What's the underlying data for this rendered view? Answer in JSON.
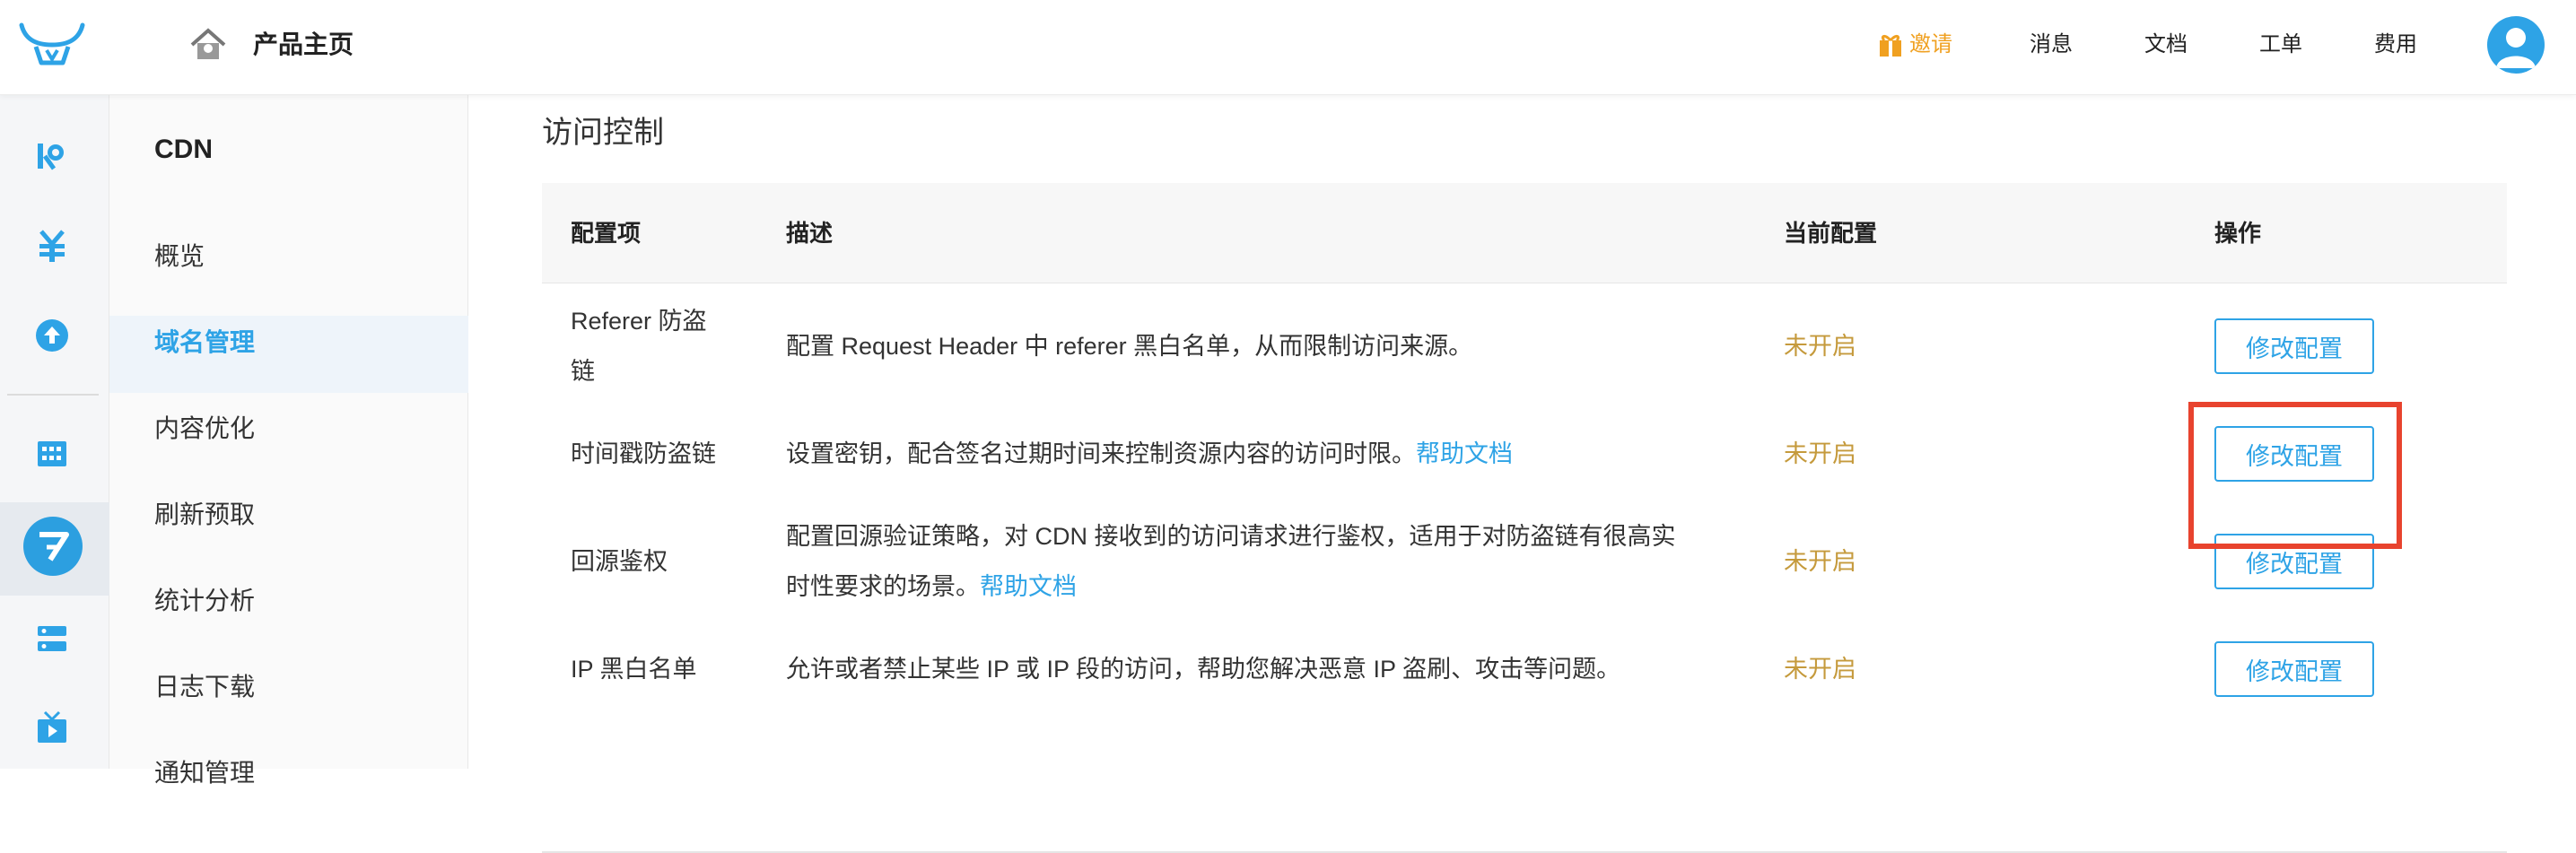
{
  "header": {
    "home_title": "产品主页",
    "nav": {
      "invite": "邀请",
      "messages": "消息",
      "docs": "文档",
      "tickets": "工单",
      "billing": "费用"
    }
  },
  "rail": {
    "icons": [
      "kodo-icon",
      "pricing-icon",
      "upload-icon",
      "dashboard-icon",
      "cdn-icon",
      "settings-icon",
      "video-icon"
    ],
    "active": "cdn-icon"
  },
  "sidebar": {
    "title": "CDN",
    "items": [
      {
        "label": "概览"
      },
      {
        "label": "域名管理",
        "active": true
      },
      {
        "label": "内容优化"
      },
      {
        "label": "刷新预取"
      },
      {
        "label": "统计分析"
      },
      {
        "label": "日志下载"
      },
      {
        "label": "通知管理"
      }
    ]
  },
  "main": {
    "section_title": "访问控制",
    "columns": [
      "配置项",
      "描述",
      "当前配置",
      "操作"
    ],
    "rows": [
      {
        "name_line1": "Referer 防盗",
        "name_line2": "链",
        "desc": "配置 Request Header 中 referer 黑白名单，从而限制访问来源。",
        "status": "未开启",
        "action": "修改配置"
      },
      {
        "name": "时间戳防盗链",
        "desc": "设置密钥，配合签名过期时间来控制资源内容的访问时限。",
        "link": "帮助文档",
        "status": "未开启",
        "action": "修改配置"
      },
      {
        "name": "回源鉴权",
        "desc_line1": "配置回源验证策略，对 CDN 接收到的访问请求进行鉴权，适用于对防盗链有很高实",
        "desc_line2": "时性要求的场景。",
        "link": "帮助文档",
        "status": "未开启",
        "action": "修改配置"
      },
      {
        "name": "IP 黑白名单",
        "desc": "允许或者禁止某些 IP 或 IP 段的访问，帮助您解决恶意 IP 盗刷、攻击等问题。",
        "status": "未开启",
        "action": "修改配置"
      }
    ]
  },
  "colors": {
    "accent": "#2ea3e6",
    "status": "#c59a3c",
    "invite": "#f0a020",
    "highlight": "#e8432e"
  }
}
